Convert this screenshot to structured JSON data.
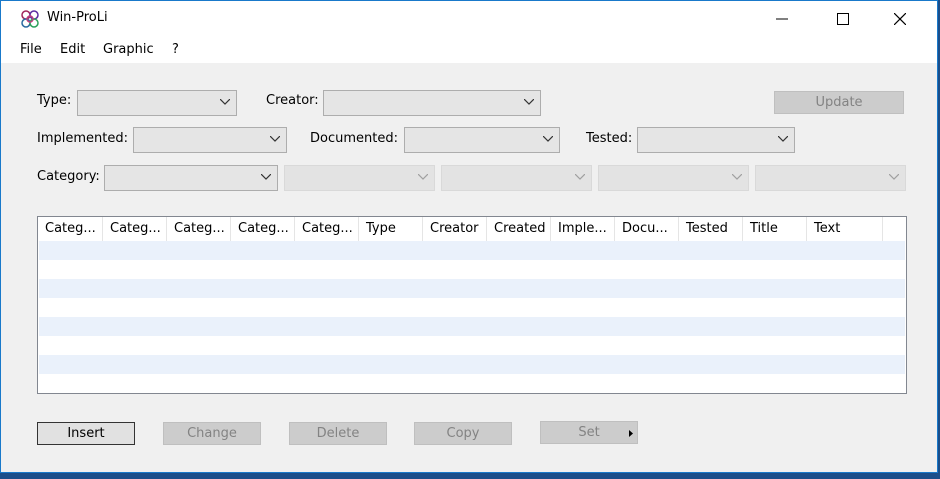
{
  "window": {
    "title": "Win-ProLi"
  },
  "menu": [
    "File",
    "Edit",
    "Graphic",
    "?"
  ],
  "filters": {
    "type_label": "Type:",
    "creator_label": "Creator:",
    "implemented_label": "Implemented:",
    "documented_label": "Documented:",
    "tested_label": "Tested:",
    "category_label": "Category:",
    "update_label": "Update"
  },
  "table": {
    "columns": [
      "Categ...",
      "Categ...",
      "Categ...",
      "Categ...",
      "Categ...",
      "Type",
      "Creator",
      "Created",
      "Imple...",
      "Docu...",
      "Tested",
      "Title",
      "Text"
    ],
    "row_stripe_color": "#eaf1fb"
  },
  "buttons": {
    "insert": "Insert",
    "change": "Change",
    "delete": "Delete",
    "copy": "Copy",
    "set": "Set"
  },
  "colors": {
    "accent": "#1979ca",
    "desktop": "#1b4e8a"
  }
}
